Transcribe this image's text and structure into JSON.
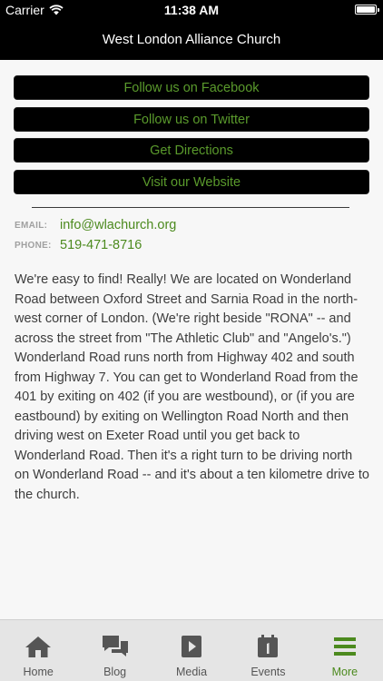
{
  "status_bar": {
    "carrier": "Carrier",
    "time": "11:38 AM"
  },
  "nav": {
    "title": "West London Alliance Church"
  },
  "actions": [
    {
      "label": "Follow us on Facebook"
    },
    {
      "label": "Follow us on Twitter"
    },
    {
      "label": "Get Directions"
    },
    {
      "label": "Visit our Website"
    }
  ],
  "contact": {
    "email_label": "EMAIL:",
    "email": "info@wlachurch.org",
    "phone_label": "PHONE:",
    "phone": "519-471-8716"
  },
  "description": "We're easy to find! Really! We are located on Wonderland Road between Oxford Street and Sarnia Road in the north-west corner of London. (We're right beside \"RONA\" -- and across the street from \"The Athletic Club\" and \"Angelo's.\") Wonderland Road runs north from Highway 402 and south from Highway 7. You can get to Wonderland Road from the 401 by exiting on 402 (if you are westbound), or (if you are eastbound) by exiting on Wellington Road North and then driving west on Exeter Road until you get back to Wonderland Road. Then it's a right turn to be driving north on Wonderland Road -- and it's about a ten kilometre drive to the church.",
  "tabs": [
    {
      "label": "Home",
      "icon": "home-icon"
    },
    {
      "label": "Blog",
      "icon": "chat-bubbles-icon"
    },
    {
      "label": "Media",
      "icon": "play-icon"
    },
    {
      "label": "Events",
      "icon": "calendar-icon"
    },
    {
      "label": "More",
      "icon": "menu-icon",
      "active": true
    }
  ],
  "colors": {
    "accent": "#4c8a1e",
    "button_bg": "#000000",
    "button_text": "#5a9a2c"
  }
}
